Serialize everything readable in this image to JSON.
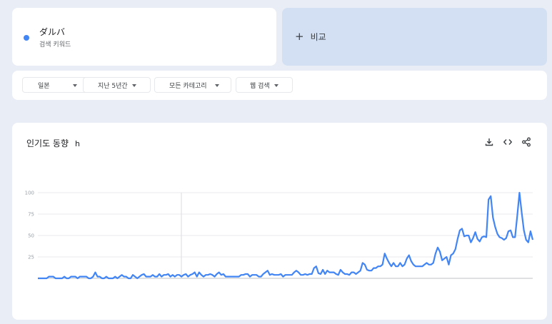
{
  "search_term": {
    "name": "ダルバ",
    "subtitle": "검색 키워드",
    "color": "#4285f4"
  },
  "compare": {
    "plus": "+",
    "label": "비교"
  },
  "filters": [
    {
      "label": "일본"
    },
    {
      "label": "지난 5년간"
    },
    {
      "label": "모든 카테고리"
    },
    {
      "label": "웹 검색"
    }
  ],
  "chart_header": {
    "title": "인기도 동향",
    "help_glyph": "h",
    "actions": [
      "download-icon",
      "embed-code-icon",
      "share-icon"
    ]
  },
  "chart_data": {
    "type": "line",
    "title": "인기도 동향",
    "xlabel": "",
    "ylabel": "",
    "ylim": [
      0,
      100
    ],
    "yticks": [
      100,
      75,
      50,
      25
    ],
    "grid": true,
    "line_color": "#4285f4",
    "series": [
      {
        "values": [
          0,
          0,
          0,
          0,
          0,
          2,
          2,
          2,
          0,
          0,
          0,
          0,
          2,
          0,
          0,
          2,
          2,
          2,
          0,
          2,
          2,
          2,
          2,
          0,
          0,
          2,
          7,
          2,
          2,
          0,
          0,
          2,
          0,
          0,
          0,
          2,
          0,
          2,
          4,
          2,
          2,
          0,
          0,
          4,
          2,
          0,
          2,
          4,
          5,
          2,
          2,
          2,
          4,
          2,
          2,
          5,
          2,
          4,
          4,
          5,
          2,
          4,
          2,
          4,
          4,
          2,
          4,
          5,
          2,
          4,
          5,
          7,
          2,
          7,
          4,
          2,
          4,
          4,
          5,
          4,
          2,
          5,
          7,
          4,
          5,
          2,
          2,
          2,
          2,
          2,
          2,
          2,
          4,
          4,
          5,
          5,
          2,
          4,
          4,
          4,
          2,
          2,
          5,
          7,
          9,
          4,
          5,
          4,
          4,
          4,
          5,
          2,
          4,
          4,
          4,
          4,
          7,
          9,
          7,
          4,
          4,
          5,
          4,
          5,
          5,
          12,
          14,
          6,
          5,
          10,
          5,
          9,
          7,
          7,
          7,
          5,
          4,
          10,
          7,
          5,
          5,
          4,
          7,
          7,
          5,
          7,
          9,
          18,
          16,
          10,
          9,
          9,
          12,
          12,
          14,
          14,
          16,
          29,
          23,
          18,
          14,
          18,
          14,
          14,
          18,
          14,
          16,
          23,
          27,
          20,
          16,
          14,
          14,
          14,
          14,
          16,
          18,
          16,
          16,
          18,
          29,
          36,
          31,
          21,
          23,
          25,
          16,
          27,
          29,
          34,
          46,
          56,
          58,
          49,
          50,
          50,
          42,
          47,
          54,
          46,
          43,
          48,
          49,
          48,
          92,
          96,
          71,
          60,
          52,
          48,
          47,
          45,
          47,
          55,
          56,
          48,
          48,
          73,
          100,
          77,
          56,
          45,
          42,
          55,
          45
        ]
      }
    ]
  }
}
